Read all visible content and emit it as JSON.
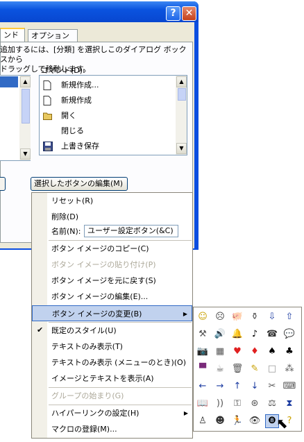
{
  "dialog": {
    "help_label": "?",
    "close_label": "✕",
    "tabs": [
      "ンド(C)",
      "オプション(O)"
    ],
    "hint_line1": "追加するには、[分類] を選択しこのダイアログ ボックスから",
    "hint_line2": "ドラッグして移動します。",
    "commands_label": "コマンド(D):",
    "commands": [
      {
        "icon": "new-document-icon",
        "label": "新規作成..."
      },
      {
        "icon": "new-document-icon",
        "label": "新規作成"
      },
      {
        "icon": "open-folder-icon",
        "label": "開く"
      },
      {
        "icon": "",
        "label": "閉じる"
      },
      {
        "icon": "save-icon",
        "label": "上書き保存"
      }
    ],
    "modify_selection_label": "選択したボタンの編集(M) ▾"
  },
  "menu": {
    "reset": "リセット(R)",
    "delete": "削除(D)",
    "name_label": "名前(N):",
    "name_value": "ユーザー設定ボタン(&C)",
    "copy_image": "ボタン イメージのコピー(C)",
    "paste_image": "ボタン イメージの貼り付け(P)",
    "reset_image": "ボタン イメージを元に戻す(S)",
    "edit_image": "ボタン イメージの編集(E)...",
    "change_image": "ボタン イメージの変更(B)",
    "default_style": "既定のスタイル(U)",
    "text_only_always": "テキストのみ表示(T)",
    "text_only_menus": "テキストのみ表示 (メニューのとき)(O)",
    "image_and_text": "イメージとテキストを表示(A)",
    "begin_group": "グループの始まり(G)",
    "hyperlink": "ハイパーリンクの設定(H)",
    "assign_macro": "マクロの登録(M)...",
    "checkmark": "✔",
    "submenu_arrow": "▶"
  },
  "palette": {
    "icons": [
      {
        "name": "smiley-icon",
        "glyph": "☺",
        "color": "#c8a000"
      },
      {
        "name": "frown-icon",
        "glyph": "☹",
        "color": "#444444"
      },
      {
        "name": "piggy-bank-icon",
        "glyph": "🐖",
        "color": "#555555"
      },
      {
        "name": "bottle-icon",
        "glyph": "⚱",
        "color": "#555555"
      },
      {
        "name": "save-down-icon",
        "glyph": "⇩",
        "color": "#1a3aa0"
      },
      {
        "name": "save-up-icon",
        "glyph": "⇧",
        "color": "#1a3aa0"
      },
      {
        "name": "wrench-icon",
        "glyph": "⚒",
        "color": "#555555"
      },
      {
        "name": "speaker-icon",
        "glyph": "🔊",
        "color": "#555555"
      },
      {
        "name": "bell-icon",
        "glyph": "🔔",
        "color": "#c8a000"
      },
      {
        "name": "music-note-icon",
        "glyph": "♪",
        "color": "#000000"
      },
      {
        "name": "telephone-icon",
        "glyph": "☎",
        "color": "#333333"
      },
      {
        "name": "speech-bubble-icon",
        "glyph": "💬",
        "color": "#555555"
      },
      {
        "name": "camera-icon",
        "glyph": "📷",
        "color": "#555555"
      },
      {
        "name": "calculator-icon",
        "glyph": "▦",
        "color": "#555555"
      },
      {
        "name": "heart-icon",
        "glyph": "♥",
        "color": "#e02020"
      },
      {
        "name": "diamond-icon",
        "glyph": "♦",
        "color": "#e02020"
      },
      {
        "name": "spade-icon",
        "glyph": "♠",
        "color": "#000000"
      },
      {
        "name": "club-icon",
        "glyph": "♣",
        "color": "#000000"
      },
      {
        "name": "paint-bucket-icon",
        "glyph": "▀",
        "color": "#7a2a7a"
      },
      {
        "name": "coffee-cup-icon",
        "glyph": "☕",
        "color": "#555555"
      },
      {
        "name": "trash-can-icon",
        "glyph": "🗑",
        "color": "#555555"
      },
      {
        "name": "pencil-icon",
        "glyph": "✎",
        "color": "#c8a000"
      },
      {
        "name": "blank-icon",
        "glyph": "□",
        "color": "#999999"
      },
      {
        "name": "footprints-icon",
        "glyph": "⁂",
        "color": "#555555"
      },
      {
        "name": "arrow-left-icon",
        "glyph": "←",
        "color": "#1a3aa0"
      },
      {
        "name": "arrow-right-icon",
        "glyph": "→",
        "color": "#1a3aa0"
      },
      {
        "name": "arrow-up-icon",
        "glyph": "↑",
        "color": "#1a3aa0"
      },
      {
        "name": "arrow-down-icon",
        "glyph": "↓",
        "color": "#1a3aa0"
      },
      {
        "name": "tools-icon",
        "glyph": "✂",
        "color": "#555555"
      },
      {
        "name": "keyboard-icon",
        "glyph": "⌨",
        "color": "#555555"
      },
      {
        "name": "book-icon",
        "glyph": "📖",
        "color": "#555555"
      },
      {
        "name": "radio-wave-icon",
        "glyph": "))",
        "color": "#555555"
      },
      {
        "name": "key-icon",
        "glyph": "⚿",
        "color": "#555555"
      },
      {
        "name": "film-reel-icon",
        "glyph": "⊛",
        "color": "#555555"
      },
      {
        "name": "scales-icon",
        "glyph": "⚖",
        "color": "#555555"
      },
      {
        "name": "hourglass-icon",
        "glyph": "⧗",
        "color": "#1a3aa0"
      },
      {
        "name": "person-icon",
        "glyph": "♙",
        "color": "#333333"
      },
      {
        "name": "head-profile-icon",
        "glyph": "☻",
        "color": "#333333"
      },
      {
        "name": "running-person-icon",
        "glyph": "🏃",
        "color": "#555555"
      },
      {
        "name": "eye-icon",
        "glyph": "👁",
        "color": "#333333"
      },
      {
        "name": "eight-ball-icon",
        "glyph": "❽",
        "color": "#000000"
      },
      {
        "name": "question-icon",
        "glyph": "?",
        "color": "#c8a000"
      }
    ]
  }
}
